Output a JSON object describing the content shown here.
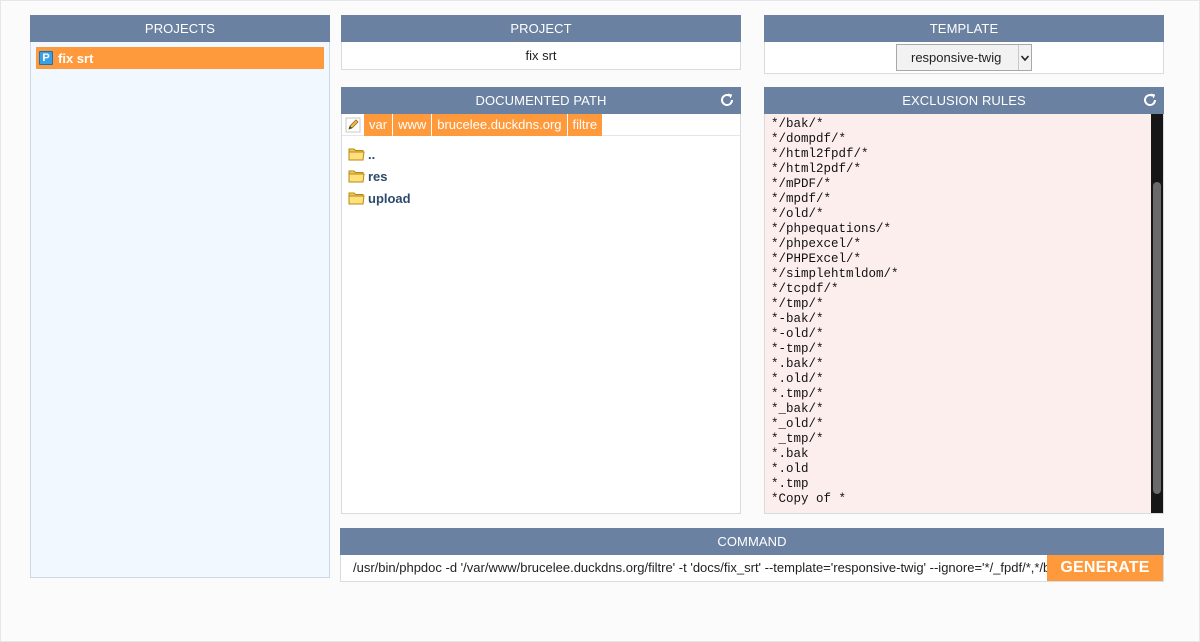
{
  "projects": {
    "header": "PROJECTS",
    "items": [
      {
        "badge": "P",
        "label": "fix srt"
      }
    ]
  },
  "project": {
    "header": "PROJECT",
    "name": "fix srt"
  },
  "template": {
    "header": "TEMPLATE",
    "selected": "responsive-twig"
  },
  "documented_path": {
    "header": "DOCUMENTED PATH",
    "breadcrumbs": [
      "var",
      "www",
      "brucelee.duckdns.org",
      "filtre"
    ],
    "entries": [
      "..",
      "res",
      "upload"
    ]
  },
  "exclusion_rules": {
    "header": "EXCLUSION RULES",
    "rules": "*/bak/*\n*/dompdf/*\n*/html2fpdf/*\n*/html2pdf/*\n*/mPDF/*\n*/mpdf/*\n*/old/*\n*/phpequations/*\n*/phpexcel/*\n*/PHPExcel/*\n*/simplehtmldom/*\n*/tcpdf/*\n*/tmp/*\n*-bak/*\n*-old/*\n*-tmp/*\n*.bak/*\n*.old/*\n*.tmp/*\n*_bak/*\n*_old/*\n*_tmp/*\n*.bak\n*.old\n*.tmp\n*Copy of *"
  },
  "command": {
    "header": "COMMAND",
    "value": "/usr/bin/phpdoc -d '/var/www/brucelee.duckdns.org/filtre' -t 'docs/fix_srt' --template='responsive-twig' --ignore='*/_fpdf/*,*/bak/*'",
    "button": "GENERATE"
  },
  "colors": {
    "header_bg": "#6b81a1",
    "accent": "#ff9a3c",
    "projects_bg": "#f2f8ff",
    "rules_bg": "#fdeeee"
  },
  "icons": {
    "refresh": "refresh-icon",
    "pencil": "pencil-icon",
    "folder": "folder-icon"
  }
}
